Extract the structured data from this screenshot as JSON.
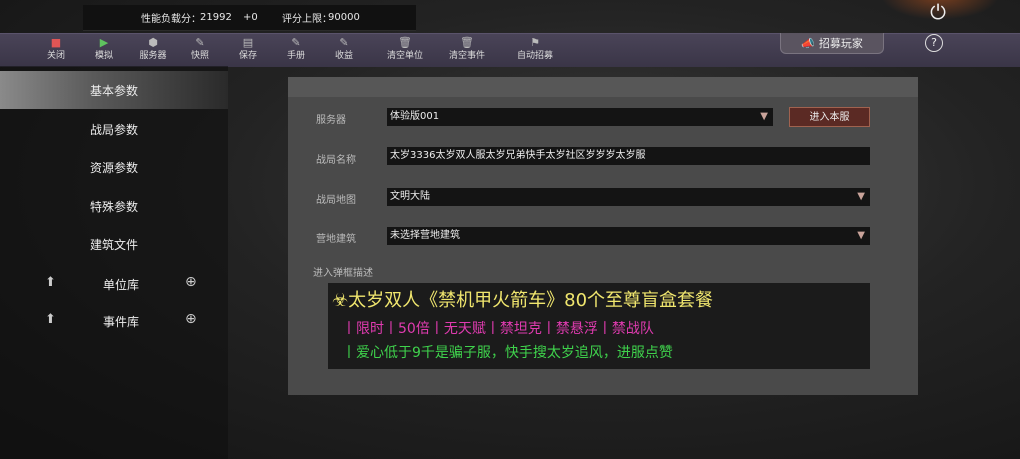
{
  "status": {
    "perf_label": "性能负载分：",
    "perf_value": "21992",
    "perf_delta": "+0",
    "score_label": "评分上限：",
    "score_value": "90000"
  },
  "toolbar": {
    "items": [
      {
        "label": "关闭",
        "icon": "stop-icon",
        "color": "#e05555"
      },
      {
        "label": "模拟",
        "icon": "play-icon",
        "color": "#5fc35f"
      },
      {
        "label": "服务器",
        "icon": "server-icon"
      },
      {
        "label": "快照",
        "icon": "snapshot-icon"
      },
      {
        "label": "保存",
        "icon": "save-icon"
      },
      {
        "label": "手册",
        "icon": "manual-icon"
      },
      {
        "label": "收益",
        "icon": "revenue-icon"
      },
      {
        "label": "清空单位",
        "icon": "trash-icon"
      },
      {
        "label": "清空事件",
        "icon": "trash-icon"
      },
      {
        "label": "自动招募",
        "icon": "flag-icon"
      }
    ],
    "recruit_label": "招募玩家"
  },
  "sidebar": {
    "items": [
      {
        "label": "基本参数",
        "active": true
      },
      {
        "label": "战局参数"
      },
      {
        "label": "资源参数"
      },
      {
        "label": "特殊参数"
      },
      {
        "label": "建筑文件"
      }
    ],
    "libraries": [
      {
        "label": "单位库"
      },
      {
        "label": "事件库"
      }
    ]
  },
  "form": {
    "server_label": "服务器",
    "server_value": "体验版001",
    "enter_button": "进入本服",
    "battle_name_label": "战局名称",
    "battle_name_value": "太岁3336太岁双人服太岁兄弟快手太岁社区岁岁岁太岁服",
    "map_label": "战局地图",
    "map_value": "文明大陆",
    "camp_label": "营地建筑",
    "camp_value": "未选择营地建筑",
    "desc_label": "进入弹框描述",
    "desc_line1": "☣太岁双人《禁机甲火箭车》80个至尊盲盒套餐",
    "desc_line2": "丨限时丨50倍丨无天赋丨禁坦克丨禁悬浮丨禁战队",
    "desc_line3": "丨爱心低于9千是骗子服，快手搜太岁追风，进服点赞"
  },
  "colors": {
    "accent": "#5b2a24",
    "toolbar_bg": "#3a3547",
    "desc_yellow": "#f0e66e",
    "desc_magenta": "#e03bb0",
    "desc_green": "#3fd24c"
  }
}
